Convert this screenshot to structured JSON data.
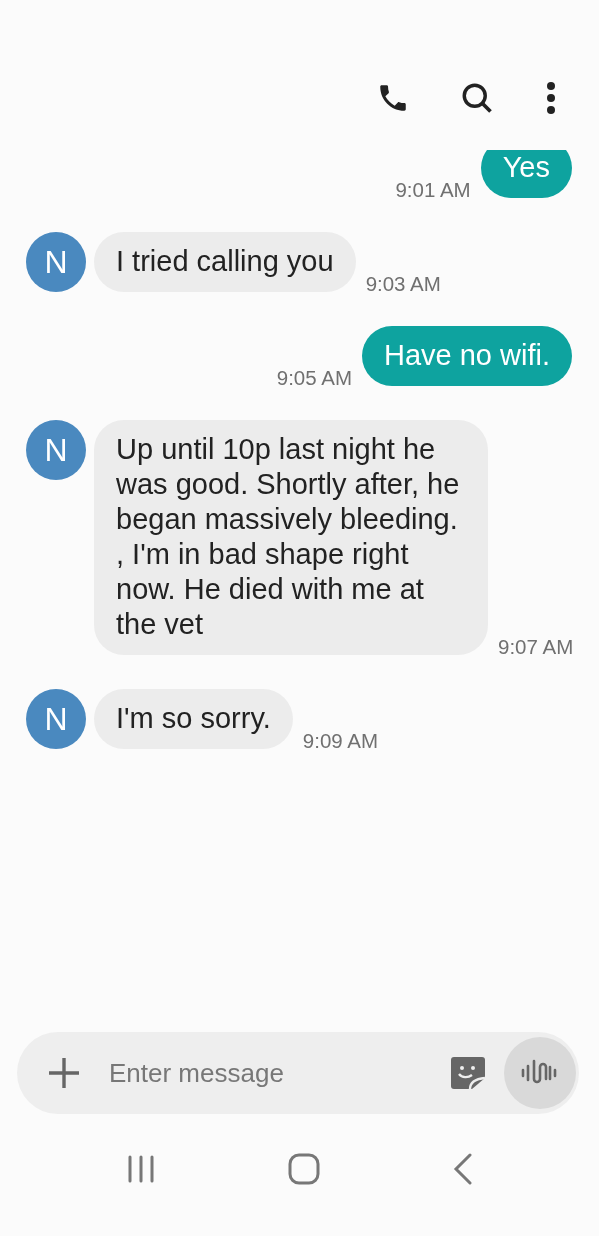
{
  "messages": [
    {
      "kind": "outgoing",
      "text": "Yes",
      "time": "9:01 AM"
    },
    {
      "kind": "incoming",
      "avatar": "N",
      "text": "I tried calling you",
      "time": "9:03 AM"
    },
    {
      "kind": "outgoing",
      "text": "Have no wifi.",
      "time": "9:05 AM"
    },
    {
      "kind": "incoming",
      "avatar": "N",
      "text": "Up until 10p last night he was good. Shortly after, he began massively bleeding. , I'm in bad shape right now. He died with me at the vet",
      "time": "9:07 AM"
    },
    {
      "kind": "incoming",
      "avatar": "N",
      "text": "I'm so sorry.",
      "time": "9:09 AM"
    }
  ],
  "composer": {
    "placeholder": "Enter message"
  }
}
